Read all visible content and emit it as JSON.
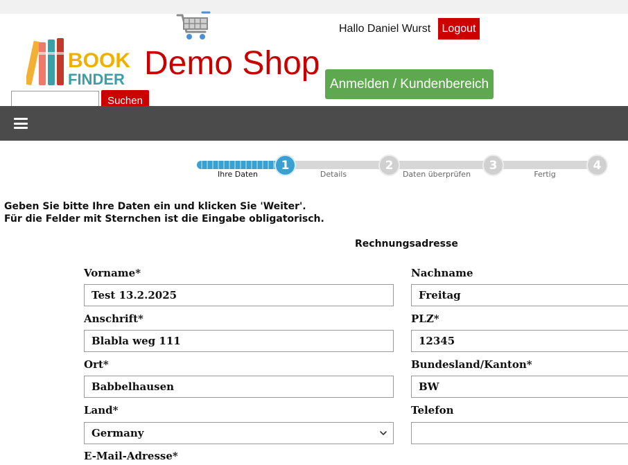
{
  "header": {
    "logo_text_top": "BOOK",
    "logo_text_bottom": "FINDER",
    "shop_title": "Demo Shop",
    "greeting": "Hallo Daniel Wurst",
    "logout_label": "Logout",
    "login_label": "Anmelden / Kundenbereich",
    "search_placeholder": "",
    "search_label": "Suchen",
    "brand_red": "#cc0000",
    "brand_green": "#5ea94f"
  },
  "nav": {
    "menu_icon": "hamburger-icon"
  },
  "progress": {
    "steps": [
      {
        "number": "1",
        "label": "Ihre Daten"
      },
      {
        "number": "2",
        "label": "Details"
      },
      {
        "number": "3",
        "label": "Daten überprüfen"
      },
      {
        "number": "4",
        "label": "Fertig"
      }
    ],
    "current_step": 1
  },
  "intro": {
    "line1": "Geben Sie bitte Ihre Daten ein und klicken Sie 'Weiter'.",
    "line2": "Für die Felder mit Sternchen ist die Eingabe obligatorisch."
  },
  "form": {
    "section_title": "Rechnungsadresse",
    "fields": {
      "vorname": {
        "label": "Vorname*",
        "value": "Test 13.2.2025"
      },
      "nachname": {
        "label": "Nachname",
        "value": "Freitag"
      },
      "anschrift": {
        "label": "Anschrift*",
        "value": "Blabla weg 111"
      },
      "plz": {
        "label": "PLZ*",
        "value": "12345"
      },
      "ort": {
        "label": "Ort*",
        "value": "Babbelhausen"
      },
      "bundesland": {
        "label": "Bundesland/Kanton*",
        "value": "BW"
      },
      "land": {
        "label": "Land*",
        "value": "Germany"
      },
      "telefon": {
        "label": "Telefon",
        "value": ""
      },
      "email": {
        "label": "E-Mail-Adresse*"
      }
    }
  }
}
